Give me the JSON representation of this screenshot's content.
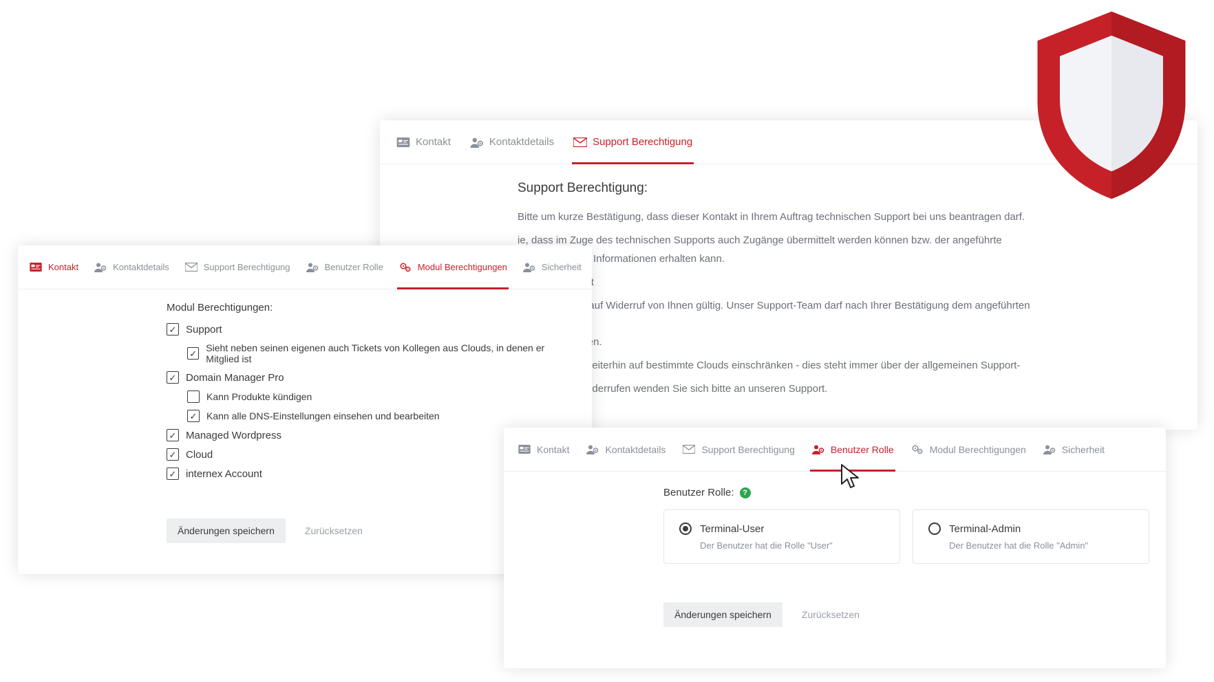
{
  "palette": {
    "accent": "#c62128"
  },
  "panelA": {
    "tabs": {
      "kontakt": "Kontakt",
      "details": "Kontaktdetails",
      "support": "Support Berechtigung"
    },
    "heading": "Support Berechtigung:",
    "p1": "Bitte um kurze Bestätigung, dass dieser Kontakt in Ihrem Auftrag technischen Support bei uns beantragen darf.",
    "p2a": "ie, dass im Zuge des technischen Supports auch Zugänge übermittelt werden können bzw. der angeführte",
    "p2b": "zu vertraulichen Informationen erhalten kann.",
    "p3": "rechtigung erteilt",
    "p4a": "chtigung ist bis auf Widerruf von Ihnen gültig. Unser Support-Team darf nach Ihrer Bestätigung dem angeführten Kontakt",
    "p4b": "ngen weiterhelfen.",
    "p5a": "ntakt natürlich weiterhin auf bestimmte Clouds einschränken - dies steht immer über der allgemeinen Support-",
    "p6": "rechtigung zu widerrufen wenden Sie sich bitte an unseren Support."
  },
  "panelB": {
    "tabs": {
      "kontakt": "Kontakt",
      "details": "Kontaktdetails",
      "support": "Support Berechtigung",
      "rolle": "Benutzer Rolle",
      "modul": "Modul Berechtigungen",
      "sicherheit": "Sicherheit"
    },
    "heading": "Modul Berechtigungen:",
    "items": {
      "support": "Support",
      "supportSub": "Sieht neben seinen eigenen auch Tickets von Kollegen aus Clouds, in denen er Mitglied ist",
      "dmp": "Domain Manager Pro",
      "dmpSub1": "Kann Produkte kündigen",
      "dmpSub2": "Kann alle DNS-Einstellungen einsehen und bearbeiten",
      "mw": "Managed Wordpress",
      "cloud": "Cloud",
      "internex": "internex Account"
    },
    "save": "Änderungen speichern",
    "reset": "Zurücksetzen"
  },
  "panelC": {
    "tabs": {
      "kontakt": "Kontakt",
      "details": "Kontaktdetails",
      "support": "Support Berechtigung",
      "rolle": "Benutzer Rolle",
      "modul": "Modul Berechtigungen",
      "sicherheit": "Sicherheit"
    },
    "label": "Benutzer Rolle:",
    "roles": {
      "user": {
        "title": "Terminal-User",
        "desc": "Der Benutzer hat die Rolle \"User\""
      },
      "admin": {
        "title": "Terminal-Admin",
        "desc": "Der Benutzer hat die Rolle \"Admin\""
      }
    },
    "save": "Änderungen speichern",
    "reset": "Zurücksetzen"
  }
}
